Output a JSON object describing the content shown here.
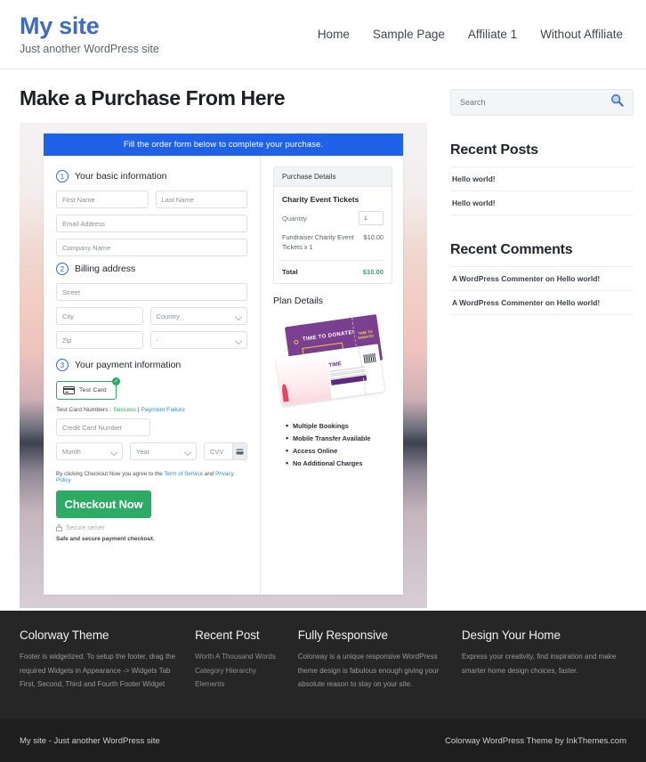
{
  "header": {
    "site_title": "My site",
    "tagline": "Just another WordPress site",
    "nav": [
      {
        "label": "Home"
      },
      {
        "label": "Sample Page"
      },
      {
        "label": "Affiliate 1"
      },
      {
        "label": "Without Affiliate"
      }
    ]
  },
  "main": {
    "page_title": "Make a Purchase From Here",
    "banner": "Fill the order form below to complete your purchase.",
    "steps": {
      "one_num": "1",
      "one_label": "Your basic information",
      "two_num": "2",
      "two_label": "Billing address",
      "three_num": "3",
      "three_label": "Your payment information"
    },
    "fields": {
      "first_name": "First Name",
      "last_name": "Last Name",
      "email": "Email Address",
      "company": "Company Name",
      "street": "Street",
      "city": "City",
      "country": "Country",
      "zip": "Zip",
      "state": "-",
      "credit_card": "Credit Card Number",
      "month": "Month",
      "year": "Year",
      "cvv": "CVV"
    },
    "payment": {
      "test_card_label": "Test Card",
      "card_icon": "credit-card-icon",
      "check_glyph": "✓",
      "note_prefix": "Test Card Numbers : ",
      "note_success": "Success",
      "note_separator": " | ",
      "note_failure": "Payment Failure",
      "terms_prefix": "By clicking Checkout Now you agree to the ",
      "terms_tos": "Term of Service",
      "terms_and": " and ",
      "terms_privacy": "Privacy Policy",
      "checkout_label": "Checkout Now",
      "secure_server": "Secure server",
      "lock_icon": "lock-icon",
      "safe_note": "Safe and secure payment checkout."
    },
    "purchase_details": {
      "panel_title": "Purchase Details",
      "product_title": "Charity Event Tickets",
      "quantity_label": "Quantity",
      "quantity_value": "1",
      "line_item": "Fundraiser Charity Event Tickets x 1",
      "line_amount": "$10.00",
      "total_label": "Total",
      "total_value": "$10.00",
      "total_color": "#2bab63"
    },
    "plan": {
      "title": "Plan Details",
      "ticket_art_name": "charity-event-ticket-image",
      "ticket_headline_a": "TIME ",
      "ticket_headline_b": "TO DONATE!",
      "ticket_stub_text": "TIME TO DONATE!",
      "features": [
        "Multiple Bookings",
        "Mobile Transfer Available",
        "Access Online",
        "No Additional Charges"
      ]
    }
  },
  "sidebar": {
    "search_placeholder": "Search",
    "search_value": "",
    "search_icon": "magnifier-icon",
    "recent_posts_title": "Recent Posts",
    "recent_posts": [
      {
        "label": "Hello world!"
      },
      {
        "label": "Hello world!"
      }
    ],
    "recent_comments_title": "Recent Comments",
    "recent_comments": [
      {
        "label": "A WordPress Commenter on Hello world!"
      },
      {
        "label": "A WordPress Commenter on Hello world!"
      }
    ]
  },
  "footer": {
    "widgets": [
      {
        "title": "Colorway Theme",
        "text": "Footer is widgetized. To setup the footer, drag the required Widgets in Appearance -> Widgets Tab First, Second, Third and Fourth Footer Widget"
      },
      {
        "title": "Recent Post",
        "items": [
          {
            "label": "Worth A Thousand Words"
          },
          {
            "label": "Category Hierarchy"
          },
          {
            "label": "Elements"
          }
        ]
      },
      {
        "title": "Fully Responsive",
        "text": "Colorway is a unique responsive WordPress theme design is fabulous enough giving your absolute reason to stay on your site."
      },
      {
        "title": "Design Your Home",
        "text": "Express your creativity, find inspiration and make smarter home design choices, faster."
      }
    ],
    "bottom_left": "My site - Just another WordPress site",
    "bottom_right": "Colorway WordPress Theme by InkThemes.com"
  }
}
